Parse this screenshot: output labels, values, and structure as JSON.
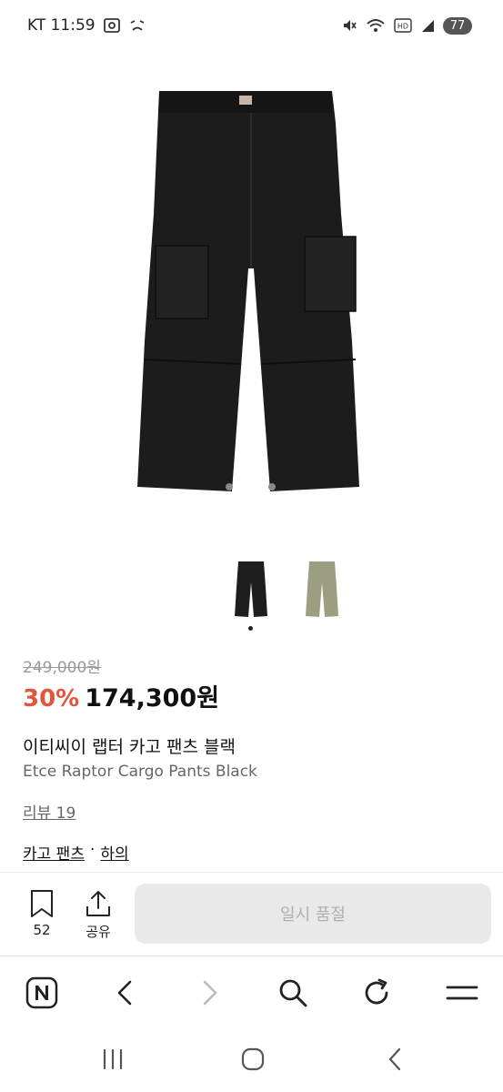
{
  "status": {
    "carrier_time": "KT 11:59",
    "battery": "77"
  },
  "product": {
    "image_alt": "black cargo pants",
    "variants": [
      {
        "name": "black",
        "color": "#1e1e1e"
      },
      {
        "name": "khaki",
        "color": "#9c9e82"
      }
    ],
    "original_price": "249,000원",
    "discount": "30%",
    "price": "174,300원",
    "name_ko": "이티씨이 랩터 카고 팬츠 블랙",
    "name_en": "Etce Raptor Cargo Pants Black",
    "reviews": "리뷰 19",
    "category": {
      "primary": "카고 팬츠",
      "separator": "·",
      "secondary": "하의"
    }
  },
  "actions": {
    "bookmark_count": "52",
    "share_label": "공유",
    "buy_label": "일시 품절"
  },
  "colors": {
    "discount": "#e2543c",
    "disabled_button_bg": "#e9e9e9",
    "disabled_button_text": "#b0b0b0"
  },
  "icons": {
    "browser": [
      "naver-icon",
      "back-icon",
      "forward-icon",
      "search-icon",
      "refresh-icon",
      "menu-icon"
    ],
    "nav": [
      "recents-icon",
      "home-icon",
      "back-icon"
    ]
  }
}
